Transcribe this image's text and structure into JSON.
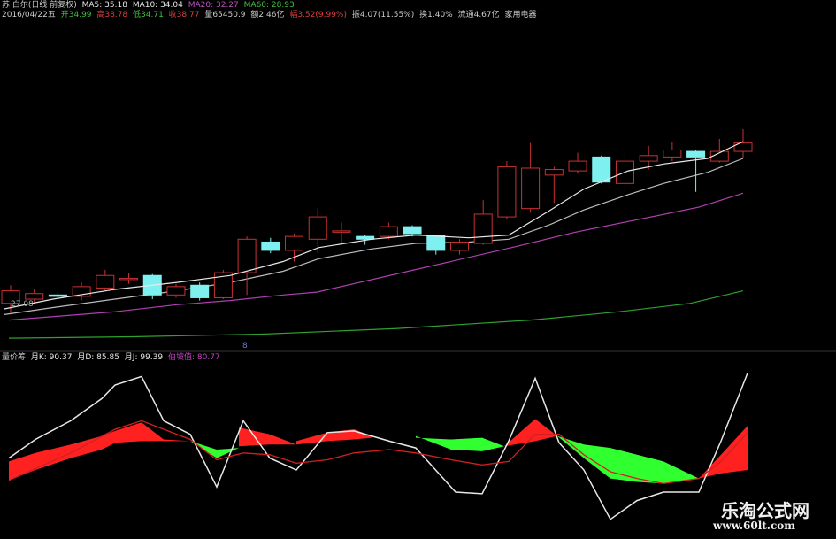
{
  "header": {
    "title": "苏 白尔(日线 前复权)",
    "ma": [
      {
        "label": "MA5: 35.18",
        "color": "#e8e8e8"
      },
      {
        "label": "MA10: 34.04",
        "color": "#e8e8e8"
      },
      {
        "label": "MA20: 32.27",
        "color": "#c050c0"
      },
      {
        "label": "MA60: 28.93",
        "color": "#40c040"
      }
    ],
    "info": [
      {
        "text": "2016/04/22五",
        "color": "#cccccc"
      },
      {
        "text": "开34.99",
        "color": "#40c040"
      },
      {
        "text": "高38.78",
        "color": "#e04040"
      },
      {
        "text": "低34.71",
        "color": "#40c040"
      },
      {
        "text": "收38.77",
        "color": "#e04040"
      },
      {
        "text": "量65450.9",
        "color": "#cccccc"
      },
      {
        "text": "额2.46亿",
        "color": "#cccccc"
      },
      {
        "text": "幅3.52(9.99%)",
        "color": "#e04040"
      },
      {
        "text": "振4.07(11.55%)",
        "color": "#cccccc"
      },
      {
        "text": "换1.40%",
        "color": "#cccccc"
      },
      {
        "text": "流通4.67亿",
        "color": "#cccccc"
      },
      {
        "text": "家用电器",
        "color": "#cccccc"
      }
    ]
  },
  "lower_header": [
    {
      "text": "量价筹",
      "color": "#cccccc"
    },
    {
      "text": "月K: 90.37",
      "color": "#e8e8e8"
    },
    {
      "text": "月D: 85.85",
      "color": "#e8e8e8"
    },
    {
      "text": "月J: 99.39",
      "color": "#e8e8e8"
    },
    {
      "text": "伯坡值: 80.77",
      "color": "#c040c0"
    }
  ],
  "price_label": "27.08",
  "marker_label": "8",
  "watermark": {
    "line1": "乐淘公式网",
    "line2": "www.60lt.com"
  },
  "colors": {
    "up": "#c83232",
    "down": "#7ff0f0",
    "ma5": "#e8e8e8",
    "ma10": "#bbbbbb",
    "ma20": "#b040b0",
    "ma60": "#30a030",
    "fill_up": "#ff2020",
    "fill_down": "#30ff30",
    "k": "#e8e8e8",
    "d": "#d02020"
  },
  "chart_data": [
    {
      "type": "candlestick",
      "ylim": [
        25,
        41
      ],
      "candles": [
        {
          "o": 28.0,
          "c": 28.9,
          "h": 29.3,
          "l": 27.3
        },
        {
          "o": 28.3,
          "c": 28.7,
          "h": 29.0,
          "l": 28.0
        },
        {
          "o": 28.6,
          "c": 28.5,
          "h": 28.8,
          "l": 28.3
        },
        {
          "o": 28.5,
          "c": 29.2,
          "h": 29.5,
          "l": 28.2
        },
        {
          "o": 29.1,
          "c": 30.0,
          "h": 30.4,
          "l": 28.9
        },
        {
          "o": 29.8,
          "c": 29.8,
          "h": 30.2,
          "l": 29.4
        },
        {
          "o": 30.0,
          "c": 28.6,
          "h": 30.1,
          "l": 28.3
        },
        {
          "o": 28.6,
          "c": 29.2,
          "h": 29.4,
          "l": 28.4
        },
        {
          "o": 29.3,
          "c": 28.4,
          "h": 29.5,
          "l": 28.2
        },
        {
          "o": 28.4,
          "c": 30.2,
          "h": 30.4,
          "l": 28.3
        },
        {
          "o": 30.2,
          "c": 32.6,
          "h": 32.8,
          "l": 28.6
        },
        {
          "o": 32.4,
          "c": 31.8,
          "h": 32.7,
          "l": 31.6
        },
        {
          "o": 31.8,
          "c": 32.8,
          "h": 33.0,
          "l": 31.0
        },
        {
          "o": 32.6,
          "c": 34.2,
          "h": 34.8,
          "l": 31.6
        },
        {
          "o": 33.2,
          "c": 33.2,
          "h": 33.8,
          "l": 32.4
        },
        {
          "o": 32.8,
          "c": 32.6,
          "h": 32.9,
          "l": 32.2
        },
        {
          "o": 32.8,
          "c": 33.5,
          "h": 33.8,
          "l": 32.6
        },
        {
          "o": 33.5,
          "c": 33.0,
          "h": 33.6,
          "l": 32.8
        },
        {
          "o": 32.9,
          "c": 31.8,
          "h": 32.9,
          "l": 31.5
        },
        {
          "o": 31.8,
          "c": 32.4,
          "h": 32.6,
          "l": 31.5
        },
        {
          "o": 32.3,
          "c": 34.4,
          "h": 35.4,
          "l": 32.2
        },
        {
          "o": 34.2,
          "c": 37.8,
          "h": 38.2,
          "l": 34.0
        },
        {
          "o": 34.8,
          "c": 37.7,
          "h": 39.5,
          "l": 34.5
        },
        {
          "o": 37.2,
          "c": 37.6,
          "h": 37.8,
          "l": 35.2
        },
        {
          "o": 37.5,
          "c": 38.2,
          "h": 38.8,
          "l": 37.3
        },
        {
          "o": 38.5,
          "c": 36.7,
          "h": 38.6,
          "l": 36.6
        },
        {
          "o": 36.6,
          "c": 38.2,
          "h": 38.7,
          "l": 36.2
        },
        {
          "o": 38.2,
          "c": 38.6,
          "h": 39.3,
          "l": 37.6
        },
        {
          "o": 38.5,
          "c": 39.0,
          "h": 39.6,
          "l": 38.2
        },
        {
          "o": 38.9,
          "c": 38.5,
          "h": 39.0,
          "l": 36.0
        },
        {
          "o": 38.2,
          "c": 38.9,
          "h": 39.8,
          "l": 38.1
        },
        {
          "o": 38.9,
          "c": 39.5,
          "h": 40.5,
          "l": 38.4
        }
      ],
      "ma5": [
        [
          5,
          27.6
        ],
        [
          60,
          28.3
        ],
        [
          130,
          29.0
        ],
        [
          200,
          29.5
        ],
        [
          260,
          30.0
        ],
        [
          320,
          31.0
        ],
        [
          360,
          32.0
        ],
        [
          420,
          32.6
        ],
        [
          470,
          32.9
        ],
        [
          530,
          32.7
        ],
        [
          575,
          32.9
        ],
        [
          620,
          34.6
        ],
        [
          660,
          36.2
        ],
        [
          710,
          37.5
        ],
        [
          750,
          38.0
        ],
        [
          800,
          38.4
        ],
        [
          840,
          39.6
        ]
      ],
      "ma10": [
        [
          5,
          27.2
        ],
        [
          60,
          27.7
        ],
        [
          130,
          28.3
        ],
        [
          200,
          28.9
        ],
        [
          260,
          29.5
        ],
        [
          320,
          30.3
        ],
        [
          360,
          31.2
        ],
        [
          420,
          31.9
        ],
        [
          470,
          32.3
        ],
        [
          530,
          32.4
        ],
        [
          575,
          32.6
        ],
        [
          620,
          33.6
        ],
        [
          660,
          34.7
        ],
        [
          710,
          35.8
        ],
        [
          750,
          36.6
        ],
        [
          800,
          37.4
        ],
        [
          840,
          38.4
        ]
      ],
      "ma20": [
        [
          10,
          26.8
        ],
        [
          130,
          27.4
        ],
        [
          200,
          27.9
        ],
        [
          260,
          28.2
        ],
        [
          320,
          28.6
        ],
        [
          358,
          28.8
        ],
        [
          585,
          32.1
        ],
        [
          650,
          33.1
        ],
        [
          720,
          34.0
        ],
        [
          790,
          34.9
        ],
        [
          840,
          35.9
        ]
      ],
      "ma60": [
        [
          10,
          25.5
        ],
        [
          150,
          25.6
        ],
        [
          300,
          25.8
        ],
        [
          450,
          26.2
        ],
        [
          600,
          26.8
        ],
        [
          700,
          27.4
        ],
        [
          780,
          28.0
        ],
        [
          840,
          28.9
        ]
      ]
    },
    {
      "type": "line",
      "ylim": [
        0,
        100
      ],
      "series": [
        {
          "name": "月K",
          "values": [
            [
              10,
              45
            ],
            [
              40,
              56
            ],
            [
              80,
              67
            ],
            [
              115,
              80
            ],
            [
              130,
              88
            ],
            [
              160,
              93
            ],
            [
              185,
              67
            ],
            [
              215,
              59
            ],
            [
              245,
              28
            ],
            [
              275,
              67
            ],
            [
              305,
              45
            ],
            [
              335,
              38
            ],
            [
              370,
              60
            ],
            [
              400,
              61
            ],
            [
              420,
              58
            ],
            [
              440,
              55
            ],
            [
              470,
              51
            ],
            [
              515,
              25
            ],
            [
              545,
              24
            ],
            [
              575,
              55
            ],
            [
              605,
              92
            ],
            [
              632,
              54
            ],
            [
              660,
              38
            ],
            [
              690,
              9
            ],
            [
              720,
              20
            ],
            [
              750,
              25
            ],
            [
              790,
              25
            ],
            [
              815,
              55
            ],
            [
              845,
              95
            ]
          ]
        },
        {
          "name": "月D",
          "values": [
            [
              10,
              32
            ],
            [
              80,
              48
            ],
            [
              130,
              62
            ],
            [
              160,
              67
            ],
            [
              185,
              62
            ],
            [
              215,
              56
            ],
            [
              245,
              44
            ],
            [
              275,
              48
            ],
            [
              305,
              47
            ],
            [
              335,
              42
            ],
            [
              370,
              44
            ],
            [
              400,
              48
            ],
            [
              440,
              50
            ],
            [
              470,
              48
            ],
            [
              510,
              44
            ],
            [
              545,
              41
            ],
            [
              575,
              43
            ],
            [
              605,
              59
            ],
            [
              632,
              59
            ],
            [
              660,
              47
            ],
            [
              690,
              37
            ],
            [
              720,
              33
            ],
            [
              750,
              30
            ],
            [
              790,
              33
            ],
            [
              815,
              43
            ],
            [
              845,
              60
            ]
          ]
        }
      ],
      "bands": [
        {
          "x": [
            10,
            40,
            80,
            115,
            130,
            160,
            185,
            215
          ],
          "upper": [
            43,
            48,
            53,
            58,
            61,
            66,
            56,
            55
          ],
          "lower": [
            32,
            38,
            45,
            50,
            54,
            55,
            55,
            55
          ],
          "sign": "up"
        },
        {
          "x": [
            215,
            245,
            270
          ],
          "upper": [
            55,
            45,
            51
          ],
          "lower": [
            55,
            50,
            51
          ],
          "sign": "down"
        },
        {
          "x": [
            270,
            305,
            335
          ],
          "upper": [
            63,
            59,
            53
          ],
          "lower": [
            52,
            53,
            53
          ],
          "sign": "up"
        },
        {
          "x": [
            335,
            370,
            400,
            420
          ],
          "upper": [
            55,
            60,
            62,
            58
          ],
          "lower": [
            53,
            55,
            56,
            57
          ],
          "sign": "up"
        },
        {
          "x": [
            470,
            510,
            545,
            570
          ],
          "upper": [
            58,
            50,
            49,
            52
          ],
          "lower": [
            57,
            56,
            57,
            52
          ],
          "sign": "down"
        },
        {
          "x": [
            570,
            605,
            630
          ],
          "upper": [
            52,
            68,
            58
          ],
          "lower": [
            52,
            55,
            58
          ],
          "sign": "up"
        },
        {
          "x": [
            630,
            660,
            690,
            720,
            750,
            790
          ],
          "upper": [
            58,
            45,
            33,
            31,
            30,
            33
          ],
          "lower": [
            58,
            53,
            51,
            47,
            43,
            33
          ],
          "sign": "down"
        },
        {
          "x": [
            790,
            815,
            845
          ],
          "upper": [
            33,
            47,
            64
          ],
          "lower": [
            33,
            36,
            38
          ],
          "sign": "up"
        }
      ]
    }
  ]
}
